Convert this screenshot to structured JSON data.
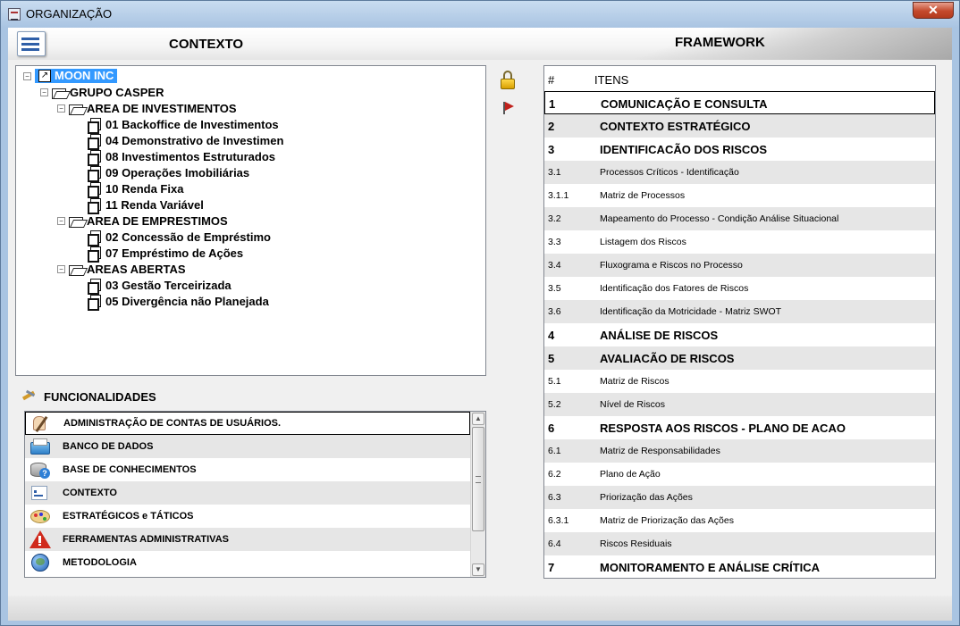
{
  "window": {
    "title": "ORGANIZAÇÃO",
    "close_label": "✕"
  },
  "header": {
    "contexto": "CONTEXTO",
    "framework": "FRAMEWORK"
  },
  "tree": {
    "root": {
      "label": "MOON INC",
      "toggle": "−"
    },
    "group": {
      "label": "GRUPO CASPER",
      "toggle": "−"
    },
    "areas": [
      {
        "label": "AREA DE INVESTIMENTOS",
        "toggle": "−",
        "items": [
          "01 Backoffice de Investimentos",
          "04 Demonstrativo de Investimen",
          "08 Investimentos Estruturados",
          "09 Operações Imobiliárias",
          "10 Renda Fixa",
          "11 Renda Variável"
        ]
      },
      {
        "label": "AREA DE EMPRESTIMOS",
        "toggle": "−",
        "items": [
          "02 Concessão de Empréstimo",
          "07 Empréstimo de Ações"
        ]
      },
      {
        "label": "AREAS ABERTAS",
        "toggle": "−",
        "items": [
          "03 Gestão Terceirizada",
          "05 Divergência não Planejada"
        ]
      }
    ]
  },
  "funcionalidades": {
    "title": "FUNCIONALIDADES",
    "items": [
      {
        "label": "ADMINISTRAÇÃO DE CONTAS DE USUÁRIOS.",
        "icon": "user-admin-icon"
      },
      {
        "label": "BANCO DE DADOS",
        "icon": "database-folder-icon"
      },
      {
        "label": "BASE DE CONHECIMENTOS",
        "icon": "knowledge-base-icon"
      },
      {
        "label": "CONTEXTO",
        "icon": "context-icon"
      },
      {
        "label": "ESTRATÉGICOS e TÁTICOS",
        "icon": "palette-icon"
      },
      {
        "label": "FERRAMENTAS ADMINISTRATIVAS",
        "icon": "warning-icon"
      },
      {
        "label": "METODOLOGIA",
        "icon": "globe-icon"
      }
    ]
  },
  "framework": {
    "col_num": "#",
    "col_items": "ITENS",
    "rows": [
      {
        "num": "1",
        "text": "COMUNICAÇÃO E CONSULTA",
        "level": "big"
      },
      {
        "num": "2",
        "text": "CONTEXTO ESTRATÉGICO",
        "level": "big"
      },
      {
        "num": "3",
        "text": "IDENTIFICACÃO DOS RISCOS",
        "level": "big"
      },
      {
        "num": "3.1",
        "text": "Processos Críticos - Identificação",
        "level": "small"
      },
      {
        "num": "3.1.1",
        "text": "Matriz de Processos",
        "level": "small"
      },
      {
        "num": "3.2",
        "text": "Mapeamento do Processo - Condição Análise Situacional",
        "level": "small"
      },
      {
        "num": "3.3",
        "text": "Listagem dos Riscos",
        "level": "small"
      },
      {
        "num": "3.4",
        "text": "Fluxograma e Riscos no Processo",
        "level": "small"
      },
      {
        "num": "3.5",
        "text": "Identificação dos Fatores de Riscos",
        "level": "small"
      },
      {
        "num": "3.6",
        "text": "Identificação da Motricidade - Matriz SWOT",
        "level": "small"
      },
      {
        "num": "4",
        "text": "ANÁLISE DE RISCOS",
        "level": "big"
      },
      {
        "num": "5",
        "text": "AVALIACÃO DE RISCOS",
        "level": "big"
      },
      {
        "num": "5.1",
        "text": "Matriz de Riscos",
        "level": "small"
      },
      {
        "num": "5.2",
        "text": "Nível de Riscos",
        "level": "small"
      },
      {
        "num": "6",
        "text": "RESPOSTA AOS RISCOS - PLANO DE ACAO",
        "level": "big"
      },
      {
        "num": "6.1",
        "text": "Matriz de Responsabilidades",
        "level": "small"
      },
      {
        "num": "6.2",
        "text": "Plano de Ação",
        "level": "small"
      },
      {
        "num": "6.3",
        "text": "Priorização das Ações",
        "level": "small"
      },
      {
        "num": "6.3.1",
        "text": "Matriz de Priorização das Ações",
        "level": "small"
      },
      {
        "num": "6.4",
        "text": "Riscos Residuais",
        "level": "small"
      },
      {
        "num": "7",
        "text": "MONITORAMENTO E ANÁLISE CRÍTICA",
        "level": "big"
      }
    ]
  },
  "side_icons": [
    "lock-icon",
    "flag-icon"
  ],
  "colors": {
    "selection": "#3399ff",
    "row_alt": "#e6e6e6",
    "frame": "#a9c4e2"
  }
}
